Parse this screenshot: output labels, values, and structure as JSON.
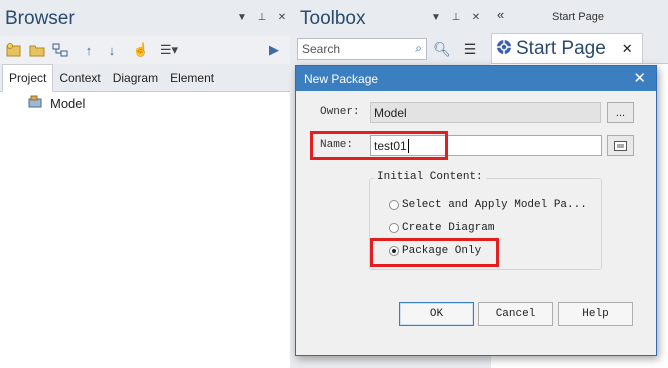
{
  "browser": {
    "title": "Browser",
    "tabs": [
      "Project",
      "Context",
      "Diagram",
      "Element"
    ],
    "active_tab": "Project",
    "tree": [
      {
        "label": "Model"
      }
    ]
  },
  "toolbox": {
    "title": "Toolbox",
    "search_placeholder": "Search"
  },
  "start_page": {
    "header": "Start Page",
    "tab_label": "Start Page"
  },
  "dialog": {
    "title": "New Package",
    "owner_label": "Owner:",
    "owner_value": "Model",
    "owner_btn": "...",
    "name_label": "Name:",
    "name_value": "test01",
    "group_title": "Initial Content:",
    "options": [
      {
        "label": "Select and Apply Model Pa...",
        "selected": false
      },
      {
        "label": "Create Diagram",
        "selected": false
      },
      {
        "label": "Package Only",
        "selected": true
      }
    ],
    "buttons": {
      "ok": "OK",
      "cancel": "Cancel",
      "help": "Help"
    }
  },
  "colors": {
    "highlight": "#e21e1e",
    "titlebar": "#3c7fc1",
    "panel_title": "#2b4a6f"
  }
}
